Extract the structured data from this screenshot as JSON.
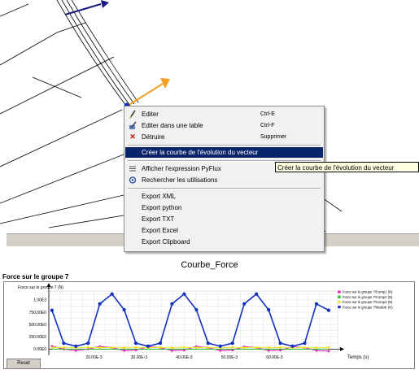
{
  "context_menu": {
    "items": [
      {
        "label": "Editer",
        "shortcut": "Ctrl-E",
        "icon": "pencil-icon"
      },
      {
        "label": "Editer dans une table",
        "shortcut": "Ctrl-F",
        "icon": "table-edit-icon"
      },
      {
        "label": "Détruire",
        "shortcut": "Supprimer",
        "icon": "delete-icon"
      },
      {
        "label": "Créer la courbe de l'évolution du vecteur",
        "shortcut": "",
        "icon": "",
        "selected": true
      },
      {
        "label": "Afficher l'expression PyFlux",
        "shortcut": "",
        "icon": "expression-icon"
      },
      {
        "label": "Rechercher les utilisations",
        "shortcut": "",
        "icon": "search-usage-icon"
      },
      {
        "label": "Export XML",
        "shortcut": "",
        "icon": ""
      },
      {
        "label": "Export python",
        "shortcut": "",
        "icon": ""
      },
      {
        "label": "Export TXT",
        "shortcut": "",
        "icon": ""
      },
      {
        "label": "Export Excel",
        "shortcut": "",
        "icon": ""
      },
      {
        "label": "Export Clipboard",
        "shortcut": "",
        "icon": ""
      }
    ]
  },
  "tooltip": {
    "text": "Créer la courbe de l'évolution du vecteur"
  },
  "caption": "Courbe_Force",
  "plot": {
    "title": "Force sur le groupe 7",
    "reset_label": "Reset"
  },
  "colors": {
    "menu_highlight": "#0a246a",
    "vector_blue": "#1a1a80",
    "vector_orange": "#f0a020",
    "curve_blue": "#1030c0",
    "curve_magenta": "#e020c0",
    "curve_yellow": "#f0e020",
    "curve_green": "#20c020",
    "curve_orange": "#f08040"
  },
  "chart_data": {
    "type": "line",
    "title": "Force sur le groupe 7",
    "ylabel": "Force sur le groupe 7 (N)",
    "xlabel": "Temps (s)",
    "x_ticks": [
      "20.00E-3",
      "30.00E-3",
      "40.00E-3",
      "50.00E-3",
      "60.00E-3"
    ],
    "x_tick_values": [
      0.02,
      0.03,
      0.04,
      0.05,
      0.06
    ],
    "y_ticks": [
      "0.00E0",
      "250.00E0",
      "500.00E0",
      "750.00E0",
      "1.00E3"
    ],
    "y_tick_values": [
      0,
      250,
      500,
      750,
      1000
    ],
    "xlim": [
      0.01,
      0.074
    ],
    "ylim": [
      -60,
      1180
    ],
    "grid": true,
    "legend_position": "top-right",
    "series": [
      {
        "name": "Force sur le groupe 7/Comp1 (N)",
        "color": "#e020c0",
        "x": [
          0.0107,
          0.0133,
          0.016,
          0.0187,
          0.0213,
          0.024,
          0.0267,
          0.0293,
          0.032,
          0.0347,
          0.0373,
          0.04,
          0.0427,
          0.0453,
          0.048,
          0.0507,
          0.0533,
          0.056,
          0.0587,
          0.0613,
          0.064,
          0.0667,
          0.0693,
          0.072
        ],
        "y": [
          60,
          0,
          -30,
          0,
          55,
          30,
          -30,
          -20,
          50,
          30,
          -30,
          -20,
          55,
          30,
          -30,
          -20,
          50,
          30,
          -30,
          -25,
          50,
          30,
          -30,
          -40
        ]
      },
      {
        "name": "Force sur le groupe 7/Comp2 (N)",
        "color": "#20c020",
        "x": [
          0.0107,
          0.072
        ],
        "y": [
          0,
          0
        ]
      },
      {
        "name": "Force sur le groupe 7/Comp3 (N)",
        "color": "#f0e020",
        "x": [
          0.0107,
          0.0133,
          0.016,
          0.0187,
          0.0213,
          0.024,
          0.0267,
          0.0293,
          0.032,
          0.0347,
          0.0373,
          0.04,
          0.0427,
          0.0453,
          0.048,
          0.0507,
          0.0533,
          0.056,
          0.0587,
          0.0613,
          0.064,
          0.0667,
          0.0693,
          0.072
        ],
        "y": [
          30,
          35,
          30,
          35,
          30,
          35,
          30,
          35,
          30,
          35,
          30,
          35,
          30,
          35,
          30,
          35,
          30,
          35,
          30,
          35,
          30,
          35,
          30,
          35
        ]
      },
      {
        "name": "Force sur le groupe 7/Module (N)",
        "color": "#1030c0",
        "x": [
          0.0107,
          0.0133,
          0.016,
          0.0187,
          0.0213,
          0.024,
          0.0267,
          0.0293,
          0.032,
          0.0347,
          0.0373,
          0.04,
          0.0427,
          0.0453,
          0.048,
          0.0507,
          0.0533,
          0.056,
          0.0587,
          0.0613,
          0.064,
          0.0667,
          0.0693,
          0.072
        ],
        "y": [
          790,
          120,
          60,
          120,
          920,
          1120,
          800,
          120,
          60,
          120,
          920,
          1120,
          800,
          120,
          60,
          120,
          920,
          1120,
          800,
          120,
          60,
          120,
          920,
          790
        ]
      }
    ]
  }
}
